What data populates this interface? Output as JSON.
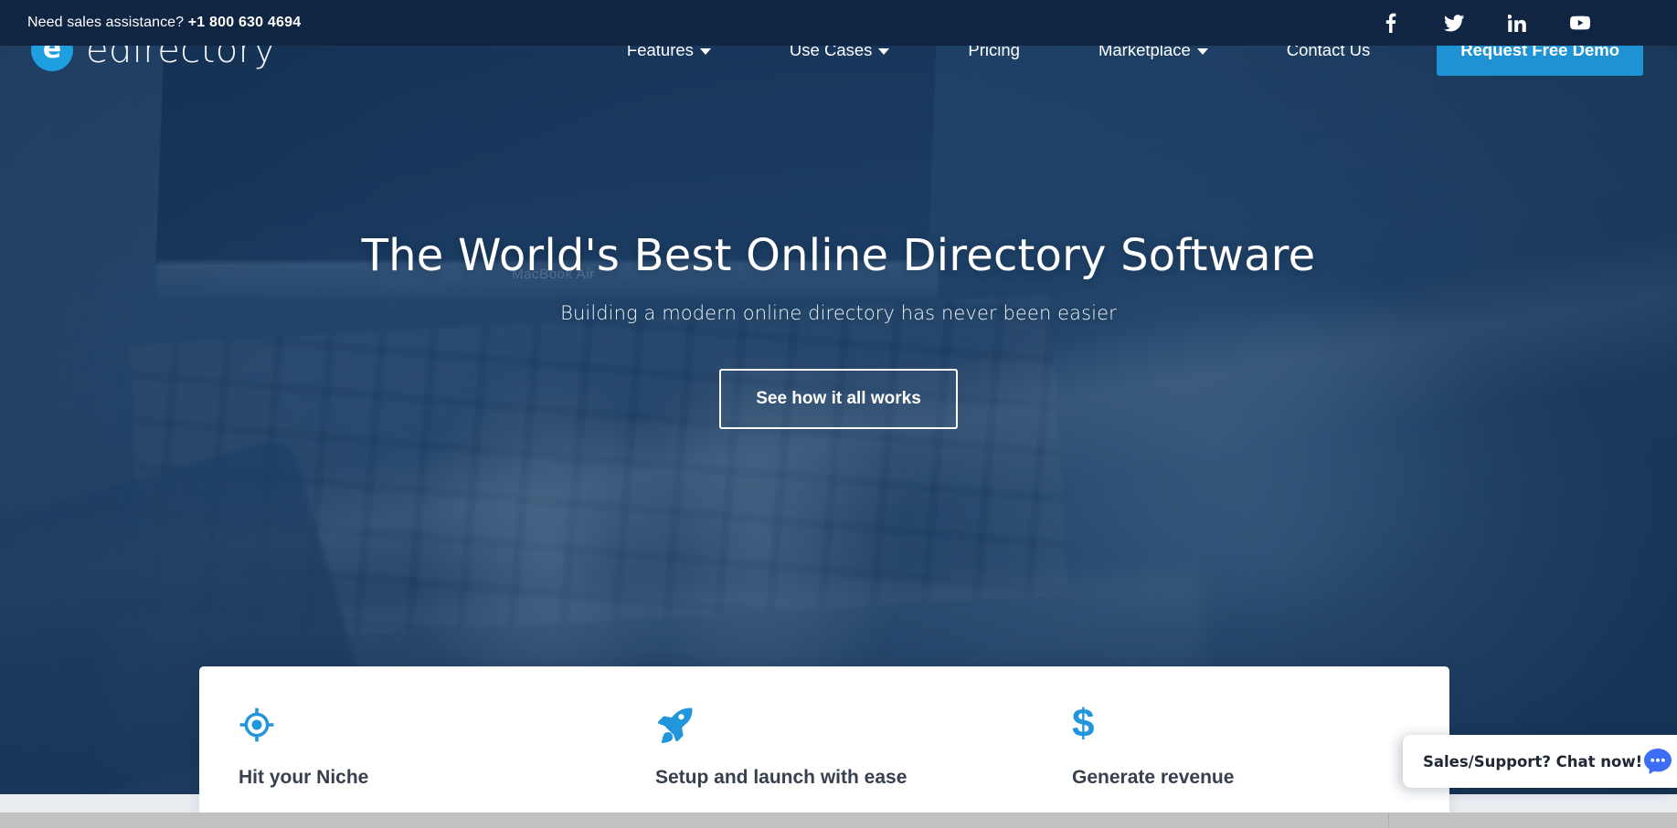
{
  "topbar": {
    "sales_label": "Need sales assistance?",
    "phone": "+1 800 630 4694",
    "social": [
      {
        "name": "facebook-icon",
        "label": "Facebook"
      },
      {
        "name": "twitter-icon",
        "label": "Twitter"
      },
      {
        "name": "linkedin-icon",
        "label": "LinkedIn"
      },
      {
        "name": "youtube-icon",
        "label": "YouTube"
      }
    ],
    "bg_color": "#102542"
  },
  "nav": {
    "logo_mark_letter": "e",
    "logo_word": "edirectory",
    "items": [
      {
        "label": "Features",
        "has_dropdown": true
      },
      {
        "label": "Use Cases",
        "has_dropdown": true
      },
      {
        "label": "Pricing",
        "has_dropdown": false
      },
      {
        "label": "Marketplace",
        "has_dropdown": true
      },
      {
        "label": "Contact Us",
        "has_dropdown": false
      }
    ],
    "cta_label": "Request Free Demo",
    "cta_color": "#1f92d4"
  },
  "hero": {
    "title": "The World's Best Online Directory Software",
    "subtitle": "Building a modern online directory has never been easier",
    "cta_label": "See how it all works",
    "background_caption": "MacBook Air"
  },
  "cards": [
    {
      "icon": "crosshair-target-icon",
      "title": "Hit your Niche"
    },
    {
      "icon": "rocket-icon",
      "title": "Setup and launch with ease"
    },
    {
      "icon": "dollar-sign-icon",
      "title": "Generate revenue",
      "glyph": "$"
    }
  ],
  "chat": {
    "text": "Sales/Support? Chat now!",
    "icon": "chat-bubble-icon",
    "bubble_color": "#3b6ef5"
  },
  "accent": {
    "brand_blue": "#1e9fe0",
    "icon_blue": "#2196dd",
    "dark_navy": "#102542",
    "hero_navy": "#1e3f64"
  }
}
